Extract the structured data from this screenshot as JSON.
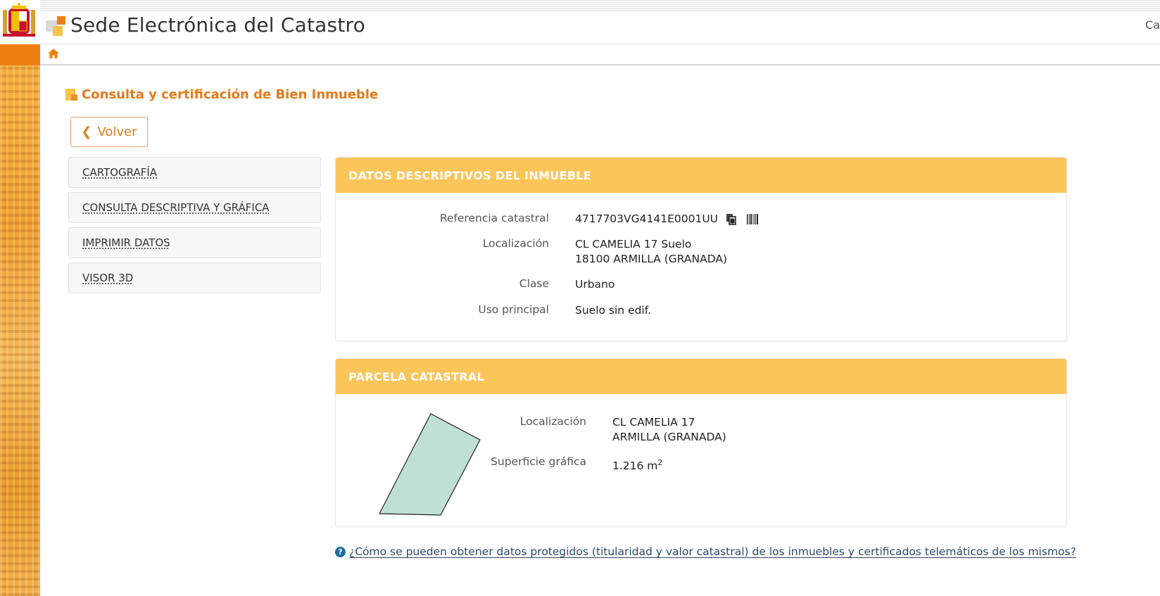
{
  "header": {
    "site_title": "Sede Electrónica del Catastro",
    "right_text": "Ca"
  },
  "colors": {
    "accent_orange": "#f07f13",
    "heading_orange": "#e57a1a",
    "panel_header_yellow": "#fcc55a",
    "parcel_fill": "#c0e0d6"
  },
  "icons": {
    "crest": "spain-coat-of-arms-icon",
    "home": "home-icon",
    "copy": "copy-icon",
    "barcode": "barcode-icon",
    "help": "question-circle-icon",
    "back": "chevron-left-icon"
  },
  "page": {
    "title": "Consulta y certificación de Bien Inmueble",
    "back_label": "Volver",
    "back_chevron": "❮"
  },
  "side_menu": {
    "items": [
      {
        "label": "CARTOGRAFÍA"
      },
      {
        "label": "CONSULTA DESCRIPTIVA Y GRÁFICA"
      },
      {
        "label": "IMPRIMIR DATOS"
      },
      {
        "label": "VISOR 3D"
      }
    ]
  },
  "datos": {
    "header": "DATOS DESCRIPTIVOS DEL INMUEBLE",
    "ref_label": "Referencia catastral",
    "ref_value": "4717703VG4141E0001UU",
    "loc_label": "Localización",
    "loc_line1": "CL CAMELIA 17 Suelo",
    "loc_line2": "18100 ARMILLA (GRANADA)",
    "clase_label": "Clase",
    "clase_value": "Urbano",
    "uso_label": "Uso principal",
    "uso_value": "Suelo sin edif."
  },
  "parcela": {
    "header": "PARCELA CATASTRAL",
    "loc_label": "Localización",
    "loc_line1": "CL CAMELIA 17",
    "loc_line2": "ARMILLA (GRANADA)",
    "sup_label": "Superficie gráfica",
    "sup_value": "1.216 m",
    "sup_unit_sup": "2"
  },
  "help": {
    "icon_text": "?",
    "link_text": "¿Cómo se pueden obtener datos protegidos (titularidad y valor catastral) de los inmuebles y certificados telemáticos de los mismos?"
  }
}
